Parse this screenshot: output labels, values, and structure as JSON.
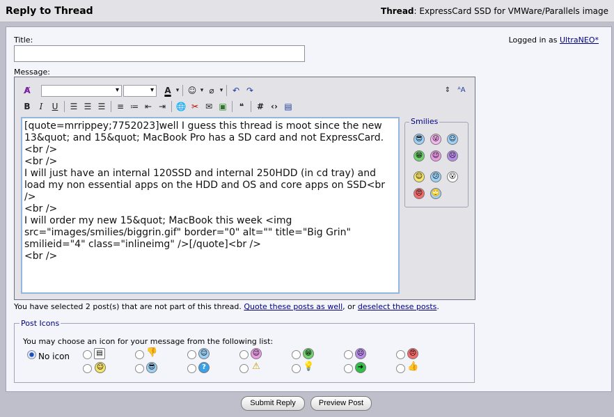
{
  "header": {
    "title": "Reply to Thread",
    "thread_label": "Thread",
    "thread_title": "ExpressCard SSD for VMWare/Parallels image"
  },
  "form": {
    "title_label": "Title:",
    "title_value": "",
    "message_label": "Message:",
    "logged_in_prefix": "Logged in as",
    "username": "UltraNEO*"
  },
  "editor": {
    "message": "[quote=mrrippey;7752023]well I guess this thread is moot since the new 13&quot; and 15&quot; MacBook Pro has a SD card and not ExpressCard.<br />\n<br />\nI will just have an internal 120SSD and internal 250HDD (in cd tray) and load my non essential apps on the HDD and OS and core apps on SSD<br />\n<br />\nI will order my new 15&quot; MacBook this week <img src=\"images/smilies/biggrin.gif\" border=\"0\" alt=\"\" title=\"Big Grin\" smilieid=\"4\" class=\"inlineimg\" />[/quote]<br />\n<br />\n",
    "smilies_label": "Smilies"
  },
  "notice": {
    "text": "You have selected 2 post(s) that are not part of this thread.",
    "quote_link": "Quote these posts as well",
    "or_text": ", or",
    "deselect_link": "deselect these posts",
    "end": "."
  },
  "post_icons": {
    "legend": "Post Icons",
    "instruction": "You may choose an icon for your message from the following list:",
    "no_icon_label": "No icon"
  },
  "buttons": {
    "submit": "Submit Reply",
    "preview": "Preview Post"
  }
}
